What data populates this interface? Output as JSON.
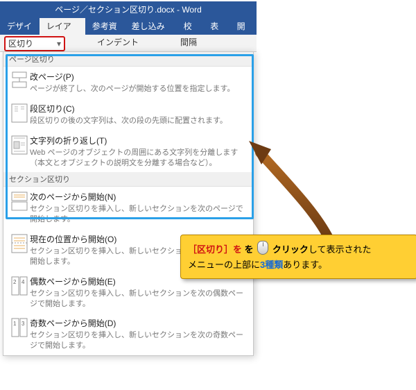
{
  "titlebar": "ページ／セクション区切り.docx  -  Word",
  "tabs": {
    "design": "デザイン",
    "layout": "レイアウト",
    "references": "参考資料",
    "mailings": "差し込み文書",
    "review": "校閲",
    "view": "表示",
    "developer": "開発"
  },
  "toolbar": {
    "breaks": "区切り",
    "indent": "インデント",
    "spacing": "間隔"
  },
  "menu": {
    "header_page": "ページ区切り",
    "header_section": "セクション区切り",
    "page": [
      {
        "title": "改ページ(P)",
        "desc": "ページが終了し、次のページが開始する位置を指定します。"
      },
      {
        "title": "段区切り(C)",
        "desc": "段区切りの後の文字列は、次の段の先頭に配置されます。"
      },
      {
        "title": "文字列の折り返し(T)",
        "desc": "Web ページのオブジェクトの周囲にある文字列を分離します（本文とオブジェクトの説明文を分離する場合など）。"
      }
    ],
    "section": [
      {
        "title": "次のページから開始(N)",
        "desc": "セクション区切りを挿入し、新しいセクションを次のページで開始します。"
      },
      {
        "title": "現在の位置から開始(O)",
        "desc": "セクション区切りを挿入し、新しいセクションを同じページで開始します。"
      },
      {
        "title": "偶数ページから開始(E)",
        "desc": "セクション区切りを挿入し、新しいセクションを次の偶数ページで開始します。"
      },
      {
        "title": "奇数ページから開始(D)",
        "desc": "セクション区切りを挿入し、新しいセクションを次の奇数ページで開始します。"
      }
    ]
  },
  "callout": {
    "p1a": "［",
    "p1b": "区切り",
    "p1c": "］を ",
    "p1d": "クリック",
    "p1e": "して表示された",
    "p2a": "メニューの上部に",
    "p2b": "3種類",
    "p2c": "あります。"
  }
}
